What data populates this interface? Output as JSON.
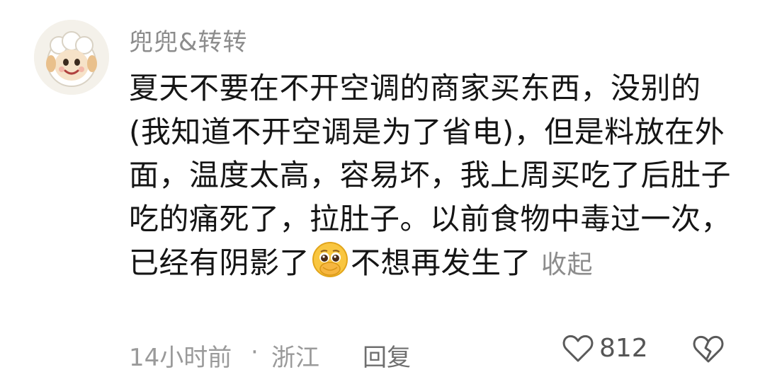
{
  "comment": {
    "username": "兜兜&转转",
    "avatar_icon": "pleasant-goat-avatar",
    "text": "夏天不要在不开空调的商家买东西，没别的(我知道不开空调是为了省电)，但是料放在外面，温度太高，容易坏，我上周买吃了后肚子吃的痛死了，拉肚子。以前食物中毒过一次，已经有阴影了",
    "emoji": "pleading-face-emoji",
    "text_after_emoji": "不想再发生了",
    "collapse_label": "收起"
  },
  "meta": {
    "time": "14小时前",
    "separator": "·",
    "location": "浙江",
    "reply_label": "回复"
  },
  "actions": {
    "like_icon": "heart-icon",
    "like_count": "812",
    "dislike_icon": "broken-heart-icon"
  }
}
